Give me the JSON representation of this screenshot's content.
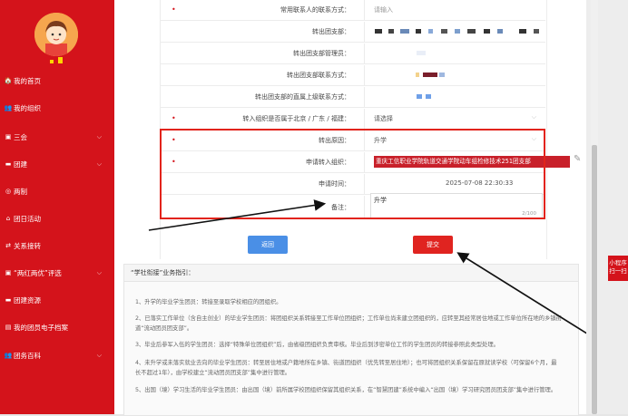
{
  "sidebar": {
    "items": [
      {
        "icon": "home-icon",
        "glyph": "🏠",
        "label": "我的首页",
        "chevron": false
      },
      {
        "icon": "organization-icon",
        "glyph": "👥",
        "label": "我的组织",
        "chevron": false
      },
      {
        "icon": "meeting-icon",
        "glyph": "▣",
        "label": "三会",
        "chevron": true
      },
      {
        "icon": "league-icon",
        "glyph": "▬",
        "label": "团建",
        "chevron": true
      },
      {
        "icon": "two-system-icon",
        "glyph": "◎",
        "label": "两制",
        "chevron": false
      },
      {
        "icon": "league-day-icon",
        "glyph": "⌂",
        "label": "团日活动",
        "chevron": false
      },
      {
        "icon": "transfer-icon",
        "glyph": "⇄",
        "label": "关系接转",
        "chevron": false
      },
      {
        "icon": "award-icon",
        "glyph": "▣",
        "label": "“两红两优”评选",
        "chevron": true
      },
      {
        "icon": "resource-icon",
        "glyph": "▬",
        "label": "团建资源",
        "chevron": false
      },
      {
        "icon": "archive-icon",
        "glyph": "▤",
        "label": "我的团员电子档案",
        "chevron": false
      },
      {
        "icon": "encyclopedia-icon",
        "glyph": "👥",
        "label": "团务百科",
        "chevron": true
      }
    ]
  },
  "form": {
    "contact_label": "常用联系人的联系方式：",
    "contact_placeholder": "请输入",
    "out_branch_label": "转出团支部：",
    "out_admin_label": "转出团支部管理员：",
    "out_contact_label": "转出团支部联系方式：",
    "out_parent_label": "转出团支部的直属上级联系方式：",
    "region_label": "转入组织是否属于北京 / 广东 / 福建：",
    "region_value": "请选择",
    "reason_label": "转出原因：",
    "reason_value": "升学",
    "target_label": "申请转入组织：",
    "target_value": "重庆工信职业学院轨道交通学院动车组检修技术251团支部",
    "time_label": "申请时间：",
    "time_value": "2025-07-08 22:30:33",
    "remark_label": "备注：",
    "remark_value": "升学",
    "remark_counter": "2/100"
  },
  "buttons": {
    "back": "返回",
    "submit": "提交"
  },
  "guide": {
    "title": "“学社衔接”业务指引：",
    "items": [
      "1、升学的毕业学生团员：转接至录取学校相应的团组织。",
      "2、已落实工作单位（含自主创业）的毕业学生团员：将团组织关系转接至工作单位团组织；工作单位尚未建立团组织的，应转至其经常居住地或工作单位所在地的乡镇街道“流动团员团支部”。",
      "3、毕业后参军入伍的学生团员：选择“特殊单位团组织”后，由省级团组织负责审核。毕业后到涉密单位工作的学生团员的转接参照此类型处理。",
      "4、未升学或未落实就业去向的毕业学生团员：转至居住地或户籍地所在乡镇、街道团组织（优先转至居住地）；也可将团组织关系保留在原就读学校（可保留6个月，最长不超过1年），由学校建立“流动团员团支部”集中进行管理。",
      "5、出国（境）学习生活的毕业学生团员：由出国（境）前所属学校团组织保留其组织关系，在“智慧团建”系统中编入“出国（境）学习研究团员团支部”集中进行管理。"
    ]
  },
  "float": {
    "mini_program": "小程序\n扫一扫"
  },
  "colors": {
    "brand_red": "#d4131b",
    "highlight_border": "#e2231a",
    "back_blue": "#4a8fe6",
    "submit_red": "#e02420"
  }
}
